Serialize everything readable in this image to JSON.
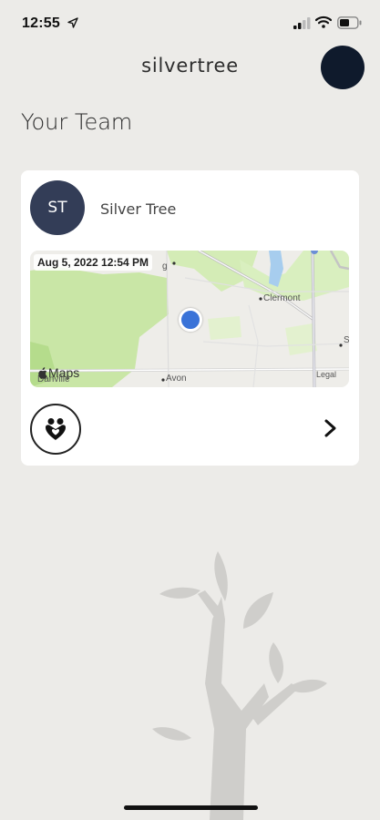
{
  "status_bar": {
    "time": "12:55",
    "icons": [
      "location-arrow-icon",
      "cellular-signal-icon",
      "wifi-icon",
      "battery-icon"
    ]
  },
  "header": {
    "brand": "silvertree",
    "profile_avatar": "profile-avatar"
  },
  "page": {
    "title": "Your Team"
  },
  "team_card": {
    "member_initials": "ST",
    "member_name": "Silver Tree",
    "map": {
      "timestamp": "Aug 5, 2022 12:54 PM",
      "labels": {
        "clermont": "Clermont",
        "avon": "Avon",
        "danville": "Danville",
        "maps": "Maps",
        "legal": "Legal",
        "g": "g",
        "s": "S"
      }
    },
    "action_icon": "heart-hands-icon",
    "chevron_icon": "chevron-right-icon"
  },
  "colors": {
    "background": "#ecebe8",
    "avatar": "#333d57",
    "location_dot": "#3a73d8",
    "tree": "#cfcecb"
  }
}
